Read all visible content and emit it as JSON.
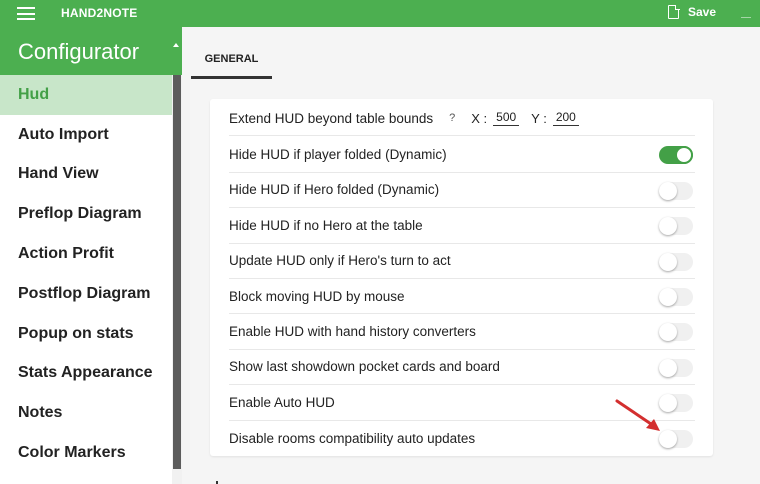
{
  "app": {
    "title": "HAND2NOTE",
    "save_label": "Save"
  },
  "sidebar": {
    "title": "Configurator",
    "items": [
      {
        "label": "Hud",
        "active": true
      },
      {
        "label": "Auto Import",
        "active": false
      },
      {
        "label": "Hand View",
        "active": false
      },
      {
        "label": "Preflop Diagram",
        "active": false
      },
      {
        "label": "Action Profit",
        "active": false
      },
      {
        "label": "Postflop Diagram",
        "active": false
      },
      {
        "label": "Popup on stats",
        "active": false
      },
      {
        "label": "Stats Appearance",
        "active": false
      },
      {
        "label": "Notes",
        "active": false
      },
      {
        "label": "Color Markers",
        "active": false
      }
    ]
  },
  "tabs": [
    {
      "label": "GENERAL",
      "active": true
    }
  ],
  "settings": {
    "extend": {
      "label": "Extend HUD beyond table bounds",
      "help": "?",
      "x_label": "X :",
      "x_value": "500",
      "y_label": "Y :",
      "y_value": "200"
    },
    "toggles": [
      {
        "label": "Hide HUD if player folded (Dynamic)",
        "on": true
      },
      {
        "label": "Hide HUD if Hero folded (Dynamic)",
        "on": false
      },
      {
        "label": "Hide HUD if no Hero at the table",
        "on": false
      },
      {
        "label": "Update HUD only if Hero's turn to act",
        "on": false
      },
      {
        "label": "Block moving HUD by mouse",
        "on": false
      },
      {
        "label": "Enable HUD with hand history converters",
        "on": false
      },
      {
        "label": "Show last showdown pocket cards and board",
        "on": false
      },
      {
        "label": "Enable Auto HUD",
        "on": false
      },
      {
        "label": "Disable rooms compatibility auto updates",
        "on": false
      }
    ]
  },
  "colors": {
    "accent": "#4caf50",
    "active_bg": "#c8e6c9",
    "arrow": "#d32f2f"
  }
}
